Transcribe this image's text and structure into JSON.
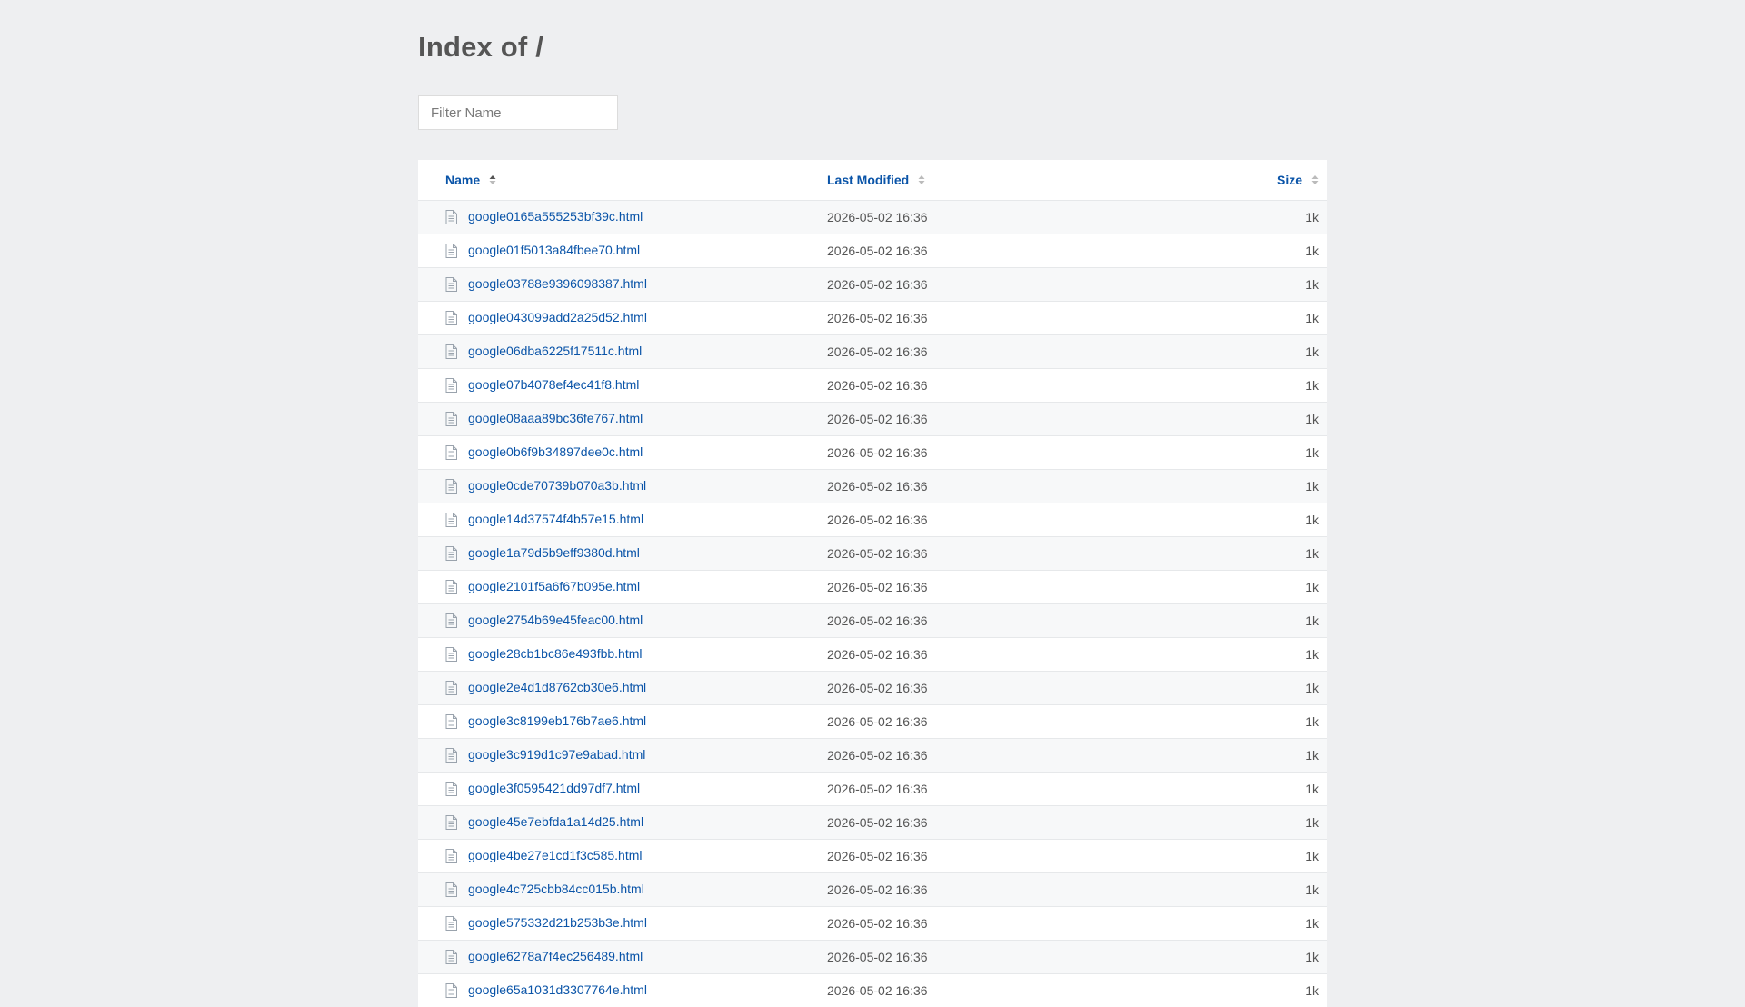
{
  "page": {
    "title": "Index of /",
    "filter_placeholder": "Filter Name"
  },
  "table": {
    "headers": {
      "name": "Name",
      "modified": "Last Modified",
      "size": "Size"
    },
    "rows": [
      {
        "name": "google0165a555253bf39c.html",
        "modified": "2026-05-02 16:36",
        "size": "1k"
      },
      {
        "name": "google01f5013a84fbee70.html",
        "modified": "2026-05-02 16:36",
        "size": "1k"
      },
      {
        "name": "google03788e9396098387.html",
        "modified": "2026-05-02 16:36",
        "size": "1k"
      },
      {
        "name": "google043099add2a25d52.html",
        "modified": "2026-05-02 16:36",
        "size": "1k"
      },
      {
        "name": "google06dba6225f17511c.html",
        "modified": "2026-05-02 16:36",
        "size": "1k"
      },
      {
        "name": "google07b4078ef4ec41f8.html",
        "modified": "2026-05-02 16:36",
        "size": "1k"
      },
      {
        "name": "google08aaa89bc36fe767.html",
        "modified": "2026-05-02 16:36",
        "size": "1k"
      },
      {
        "name": "google0b6f9b34897dee0c.html",
        "modified": "2026-05-02 16:36",
        "size": "1k"
      },
      {
        "name": "google0cde70739b070a3b.html",
        "modified": "2026-05-02 16:36",
        "size": "1k"
      },
      {
        "name": "google14d37574f4b57e15.html",
        "modified": "2026-05-02 16:36",
        "size": "1k"
      },
      {
        "name": "google1a79d5b9eff9380d.html",
        "modified": "2026-05-02 16:36",
        "size": "1k"
      },
      {
        "name": "google2101f5a6f67b095e.html",
        "modified": "2026-05-02 16:36",
        "size": "1k"
      },
      {
        "name": "google2754b69e45feac00.html",
        "modified": "2026-05-02 16:36",
        "size": "1k"
      },
      {
        "name": "google28cb1bc86e493fbb.html",
        "modified": "2026-05-02 16:36",
        "size": "1k"
      },
      {
        "name": "google2e4d1d8762cb30e6.html",
        "modified": "2026-05-02 16:36",
        "size": "1k"
      },
      {
        "name": "google3c8199eb176b7ae6.html",
        "modified": "2026-05-02 16:36",
        "size": "1k"
      },
      {
        "name": "google3c919d1c97e9abad.html",
        "modified": "2026-05-02 16:36",
        "size": "1k"
      },
      {
        "name": "google3f0595421dd97df7.html",
        "modified": "2026-05-02 16:36",
        "size": "1k"
      },
      {
        "name": "google45e7ebfda1a14d25.html",
        "modified": "2026-05-02 16:36",
        "size": "1k"
      },
      {
        "name": "google4be27e1cd1f3c585.html",
        "modified": "2026-05-02 16:36",
        "size": "1k"
      },
      {
        "name": "google4c725cbb84cc015b.html",
        "modified": "2026-05-02 16:36",
        "size": "1k"
      },
      {
        "name": "google575332d21b253b3e.html",
        "modified": "2026-05-02 16:36",
        "size": "1k"
      },
      {
        "name": "google6278a7f4ec256489.html",
        "modified": "2026-05-02 16:36",
        "size": "1k"
      },
      {
        "name": "google65a1031d3307764e.html",
        "modified": "2026-05-02 16:36",
        "size": "1k"
      }
    ]
  },
  "colors": {
    "background": "#eeeff1",
    "link": "#0a54a8",
    "text": "#555555"
  },
  "icons": {
    "file": "file-icon",
    "sort": "sort-icon"
  }
}
